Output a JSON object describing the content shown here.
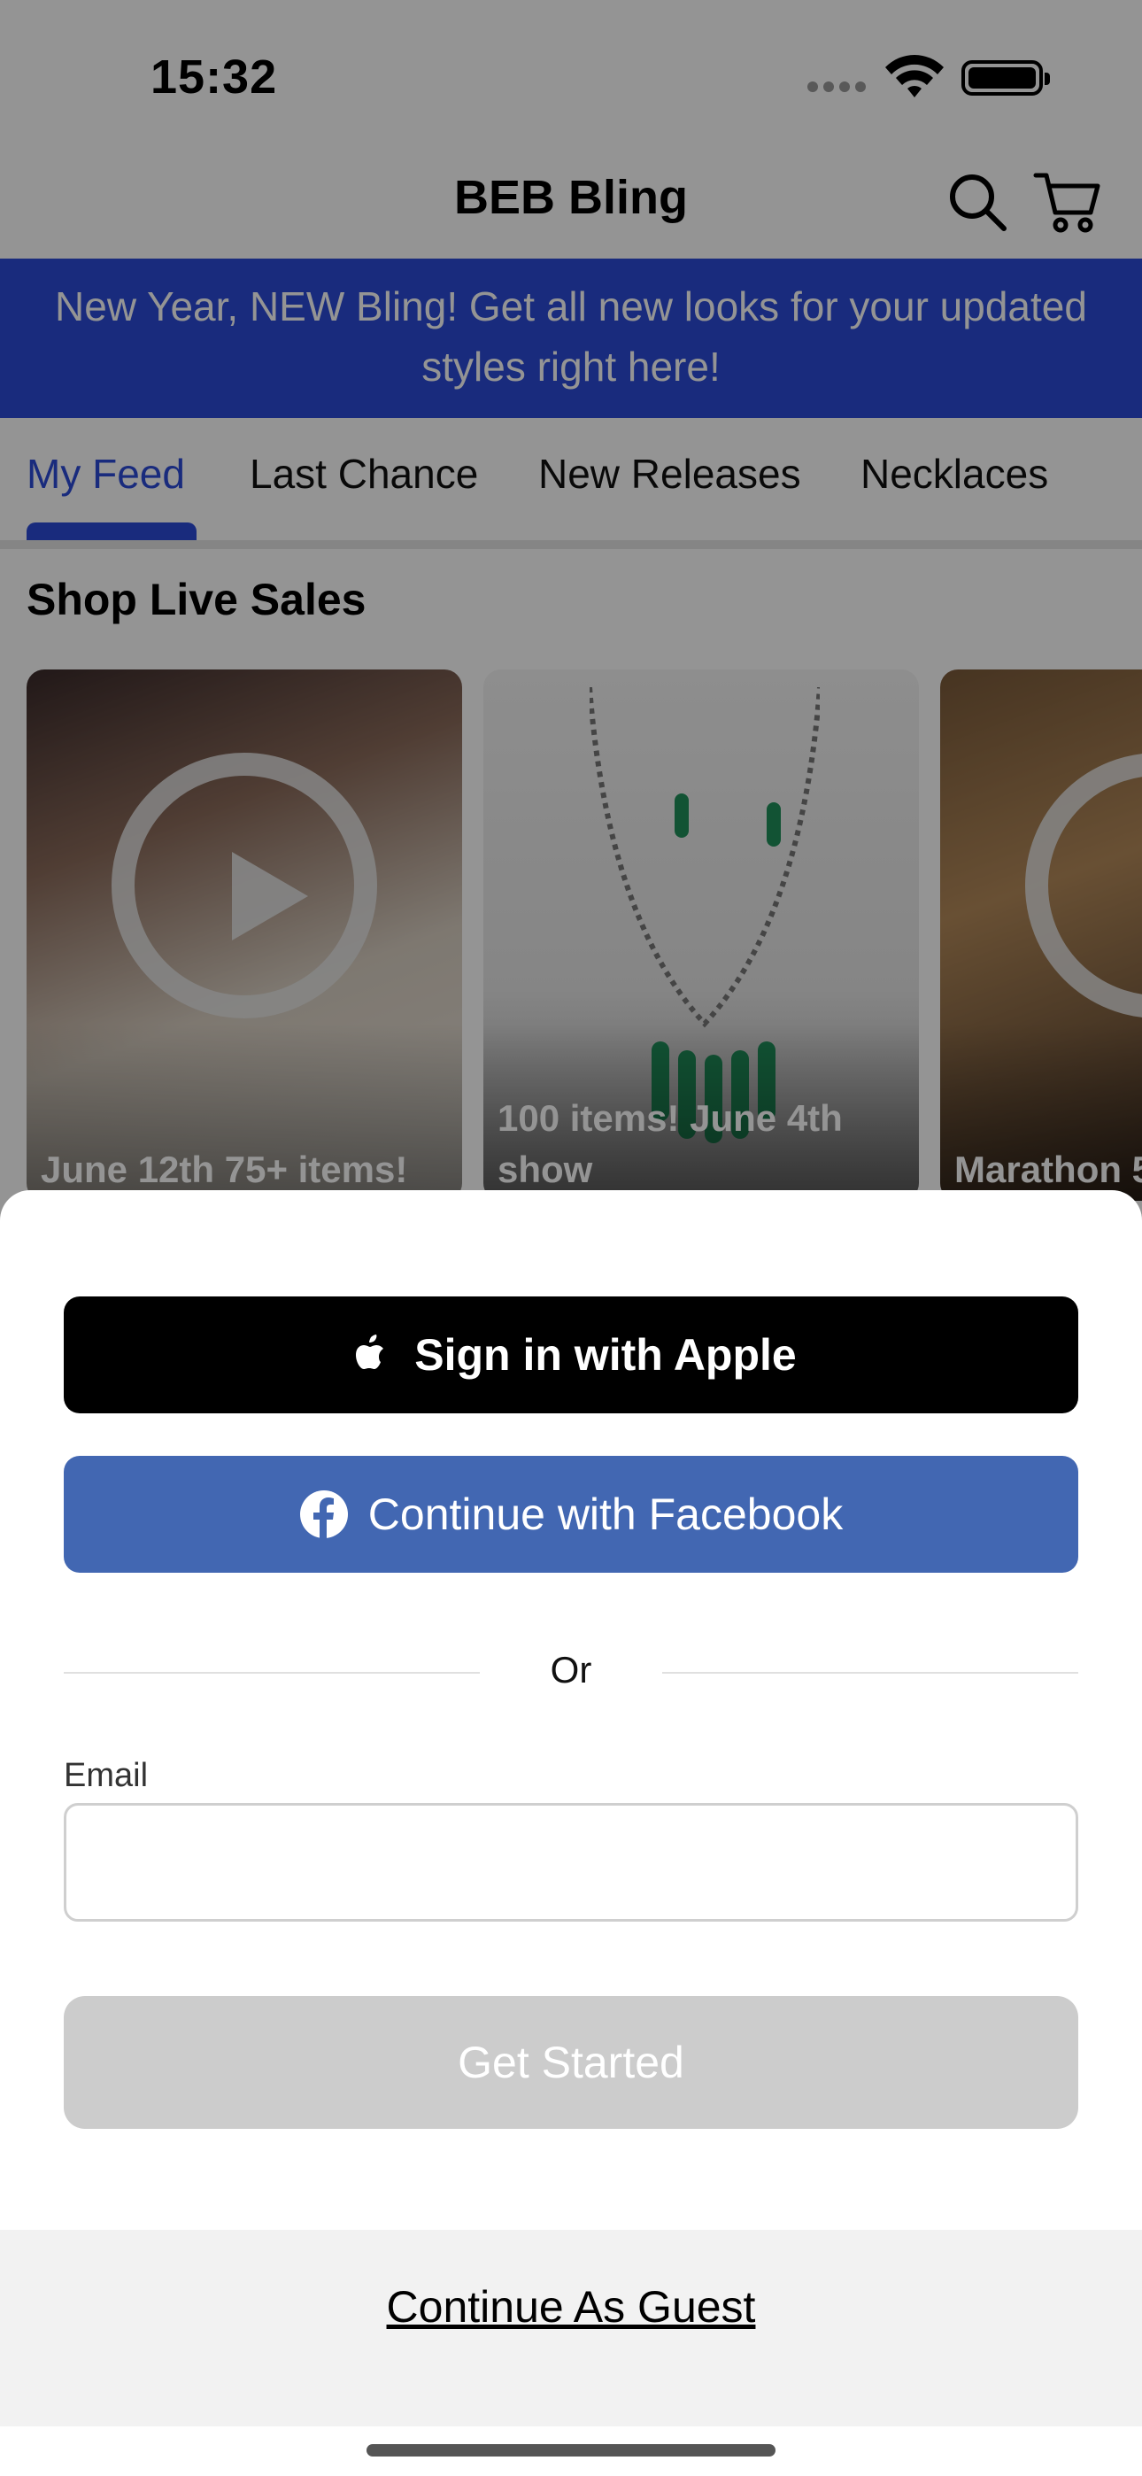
{
  "status_bar": {
    "time": "15:32"
  },
  "nav": {
    "title": "BEB Bling",
    "search_icon": "search-icon",
    "cart_icon": "cart-icon"
  },
  "promo_banner": {
    "text": "New Year, NEW Bling! Get all new looks for your updated styles right here!"
  },
  "tabs": [
    {
      "label": "My Feed",
      "active": true
    },
    {
      "label": "Last Chance",
      "active": false
    },
    {
      "label": "New Releases",
      "active": false
    },
    {
      "label": "Necklaces",
      "active": false
    }
  ],
  "live_sales": {
    "title": "Shop Live Sales",
    "cards": [
      {
        "caption": "June 12th 75+ items!"
      },
      {
        "caption": "100 items! June 4th show"
      },
      {
        "caption": "Marathon 5"
      }
    ]
  },
  "sheet": {
    "apple_label": "Sign in with Apple",
    "facebook_label": "Continue with Facebook",
    "divider_text": "Or",
    "email_label": "Email",
    "email_value": "",
    "email_placeholder": "",
    "get_started_label": "Get Started",
    "guest_label": "Continue As Guest"
  },
  "colors": {
    "brand_blue": "#2b4bd8",
    "facebook_blue": "#4267b2",
    "apple_black": "#000000",
    "disabled_gray": "#cccccc"
  }
}
